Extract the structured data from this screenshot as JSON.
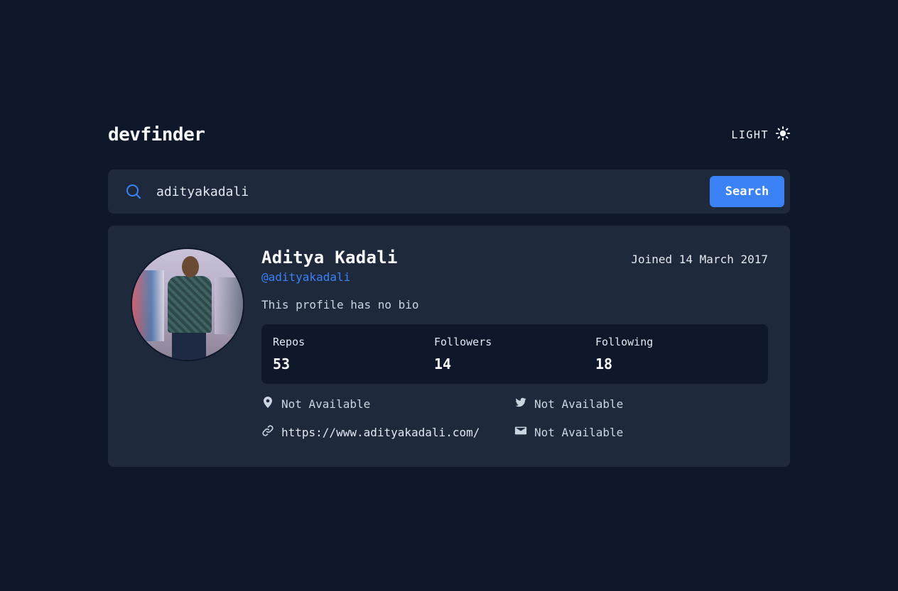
{
  "app": {
    "logo": "devfinder",
    "theme_label": "LIGHT"
  },
  "search": {
    "value": "adityakadali",
    "placeholder": "Search GitHub username…",
    "button_label": "Search"
  },
  "profile": {
    "name": "Aditya Kadali",
    "handle": "@adityakadali",
    "joined": "Joined 14 March 2017",
    "bio": "This profile has no bio",
    "stats": [
      {
        "label": "Repos",
        "value": "53"
      },
      {
        "label": "Followers",
        "value": "14"
      },
      {
        "label": "Following",
        "value": "18"
      }
    ],
    "links": {
      "location": "Not Available",
      "twitter": "Not Available",
      "website": "https://www.adityakadali.com/",
      "company": "Not Available"
    }
  },
  "colors": {
    "background": "#0f172a",
    "card": "#1e293b",
    "accent": "#3b82f6"
  }
}
